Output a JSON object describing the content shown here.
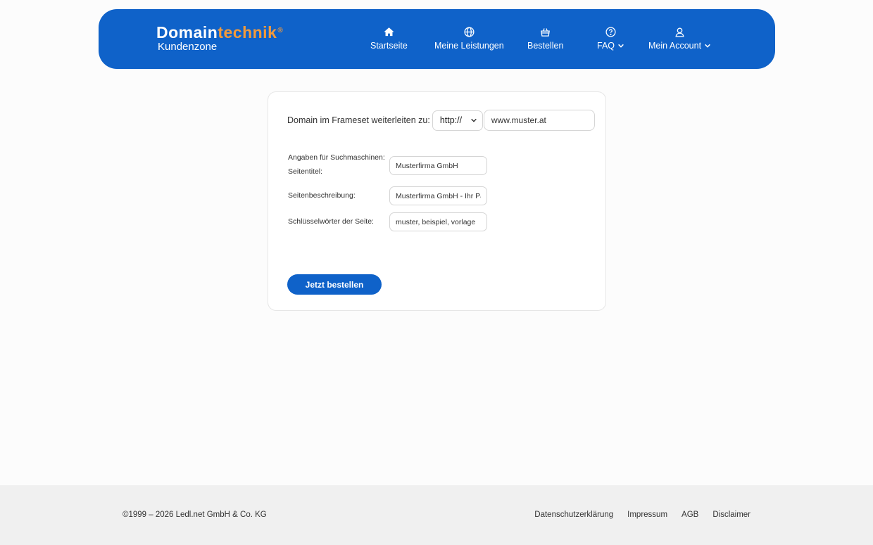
{
  "header": {
    "logo_main": "Domain",
    "logo_accent": "technik",
    "logo_reg": "®",
    "logo_sub": "Kundenzone",
    "nav": [
      {
        "label": "Startseite",
        "icon": "home-icon"
      },
      {
        "label": "Meine Leistungen",
        "icon": "globe-icon"
      },
      {
        "label": "Bestellen",
        "icon": "basket-icon"
      },
      {
        "label": "FAQ",
        "icon": "help-circle-icon",
        "dropdown": true
      },
      {
        "label": "Mein Account",
        "icon": "user-icon",
        "dropdown": true
      }
    ]
  },
  "form": {
    "redirect_label": "Domain im Frameset weiterleiten zu:",
    "protocol_value": "http://",
    "url_value": "www.muster.at",
    "seo_heading": "Angaben für Suchmaschinen:",
    "title_label": "Seitentitel:",
    "title_value": "Musterfirma GmbH",
    "description_label": "Seitenbeschreibung:",
    "description_value": "Musterfirma GmbH - Ihr Pa",
    "keywords_label": "Schlüsselwörter der Seite:",
    "keywords_value": "muster, beispiel, vorlage",
    "submit_label": "Jetzt bestellen"
  },
  "footer": {
    "copyright": "©1999 – 2026 Ledl.net GmbH & Co. KG",
    "links": [
      "Datenschutzerklärung",
      "Impressum",
      "AGB",
      "Disclaimer"
    ]
  },
  "colors": {
    "brand_blue": "#0f62c9",
    "accent_orange": "#f39a3b"
  }
}
